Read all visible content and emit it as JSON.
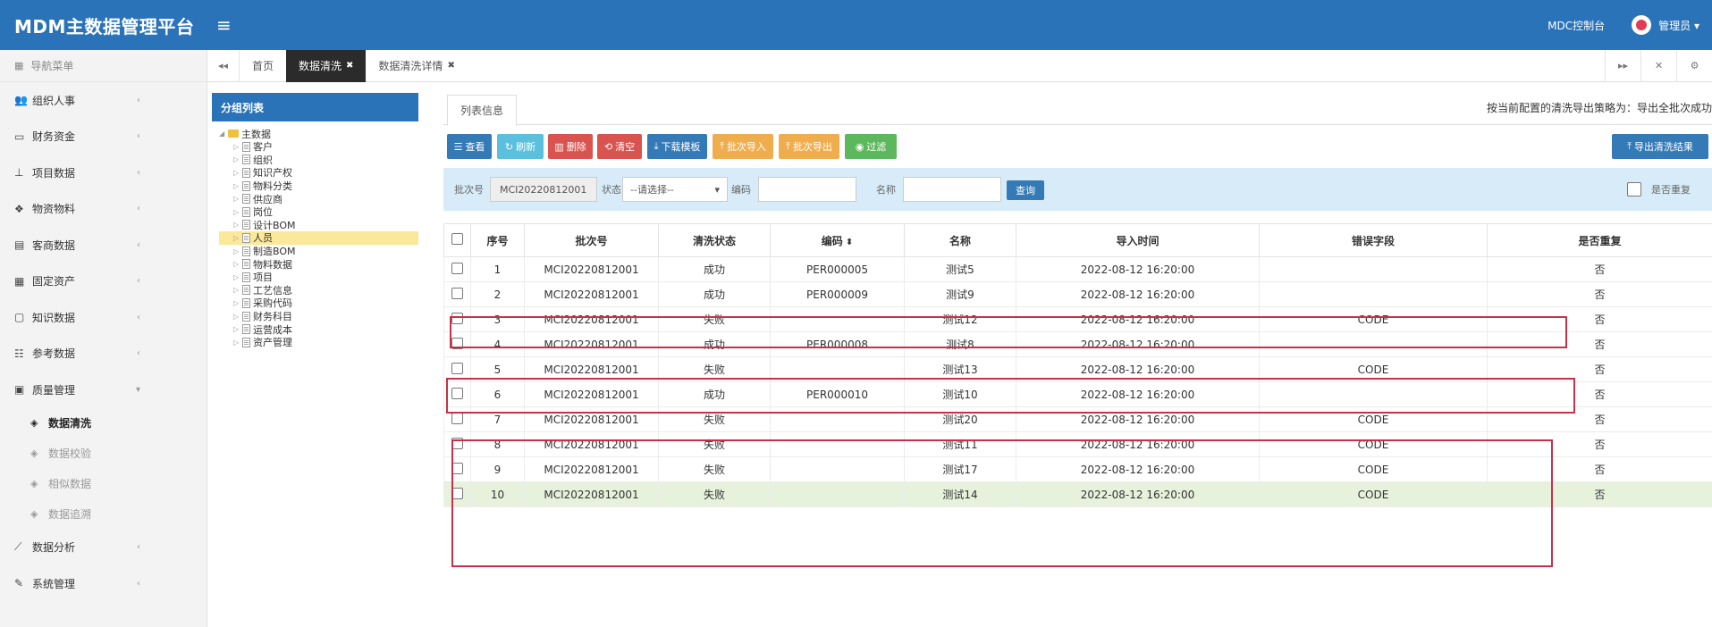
{
  "app": {
    "title": "MDM主数据管理平台",
    "console": "MDC控制台",
    "user": "管理员 ▾"
  },
  "sidebar": {
    "header": "导航菜单",
    "items": [
      {
        "label": "组织人事",
        "icon": "users-icon"
      },
      {
        "label": "财务资金",
        "icon": "card-icon"
      },
      {
        "label": "项目数据",
        "icon": "sitemap-icon"
      },
      {
        "label": "物资物料",
        "icon": "cubes-icon"
      },
      {
        "label": "客商数据",
        "icon": "building-icon"
      },
      {
        "label": "固定资产",
        "icon": "asset-icon"
      },
      {
        "label": "知识数据",
        "icon": "file-icon"
      },
      {
        "label": "参考数据",
        "icon": "list-icon"
      },
      {
        "label": "质量管理",
        "icon": "quality-icon"
      }
    ],
    "sub_items": [
      {
        "label": "数据清洗",
        "active": true
      },
      {
        "label": "数据校验",
        "active": false
      },
      {
        "label": "相似数据",
        "active": false
      },
      {
        "label": "数据追溯",
        "active": false
      }
    ],
    "bottom_items": [
      {
        "label": "数据分析",
        "icon": "chart-icon"
      },
      {
        "label": "系统管理",
        "icon": "wrench-icon"
      }
    ]
  },
  "tabs": [
    {
      "label": "首页",
      "active": false,
      "closable": false
    },
    {
      "label": "数据清洗",
      "active": true,
      "closable": true
    },
    {
      "label": "数据清洗详情",
      "active": false,
      "closable": true
    }
  ],
  "tree": {
    "header": "分组列表",
    "root": "主数据",
    "selected_index": 10,
    "nodes": [
      "客户",
      "组织",
      "知识产权",
      "物料分类",
      "供应商",
      "岗位",
      "设计BOM",
      "人员",
      "制造BOM",
      "物料数据",
      "项目",
      "工艺信息",
      "采购代码",
      "财务科目",
      "运营成本",
      "资产管理"
    ]
  },
  "main": {
    "inner_tab": "列表信息",
    "notice": "按当前配置的清洗导出策略为：导出全批次成功",
    "toolbar": {
      "query": "查看",
      "refresh": "刷新",
      "delete": "删除",
      "clear": "清空",
      "download_template": "下载模板",
      "import": "批次导入",
      "export": "批次导出",
      "filter": "过滤",
      "export_result": "导出清洗结果"
    },
    "search": {
      "batch_label": "批次号",
      "batch_value": "MCI20220812001",
      "status_label": "状态",
      "status_value": "--请选择--",
      "code_label": "编码",
      "code_value": "",
      "name_label": "名称",
      "name_value": "",
      "search_button": "查询",
      "repeat_label": "是否重复"
    }
  },
  "table": {
    "headers": [
      "",
      "序号",
      "批次号",
      "清洗状态",
      "编码",
      "名称",
      "导入时间",
      "错误字段",
      "是否重复"
    ],
    "rows": [
      [
        "1",
        "MCI20220812001",
        "成功",
        "PER000005",
        "测试5",
        "2022-08-12 16:20:00",
        "",
        "否"
      ],
      [
        "2",
        "MCI20220812001",
        "成功",
        "PER000009",
        "测试9",
        "2022-08-12 16:20:00",
        "",
        "否"
      ],
      [
        "3",
        "MCI20220812001",
        "失败",
        "",
        "测试12",
        "2022-08-12 16:20:00",
        "CODE",
        "否"
      ],
      [
        "4",
        "MCI20220812001",
        "成功",
        "PER000008",
        "测试8",
        "2022-08-12 16:20:00",
        "",
        "否"
      ],
      [
        "5",
        "MCI20220812001",
        "失败",
        "",
        "测试13",
        "2022-08-12 16:20:00",
        "CODE",
        "否"
      ],
      [
        "6",
        "MCI20220812001",
        "成功",
        "PER000010",
        "测试10",
        "2022-08-12 16:20:00",
        "",
        "否"
      ],
      [
        "7",
        "MCI20220812001",
        "失败",
        "",
        "测试20",
        "2022-08-12 16:20:00",
        "CODE",
        "否"
      ],
      [
        "8",
        "MCI20220812001",
        "失败",
        "",
        "测试11",
        "2022-08-12 16:20:00",
        "CODE",
        "否"
      ],
      [
        "9",
        "MCI20220812001",
        "失败",
        "",
        "测试17",
        "2022-08-12 16:20:00",
        "CODE",
        "否"
      ],
      [
        "10",
        "MCI20220812001",
        "失败",
        "",
        "测试14",
        "2022-08-12 16:20:00",
        "CODE",
        "否"
      ]
    ],
    "highlight_row": 10
  },
  "colors": {
    "primary": "#2a73b8",
    "highlight_row": "#e6f2dc",
    "annotation": "#c8304a"
  }
}
